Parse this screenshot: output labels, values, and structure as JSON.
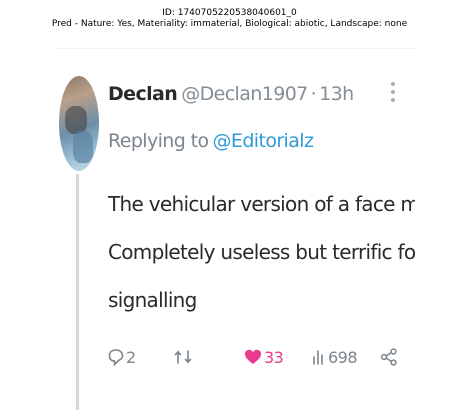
{
  "caption": {
    "line1": "ID: 1740705220538040601_0",
    "line2": "Pred - Nature: Yes, Materiality: immaterial, Biological: abiotic, Landscape: none"
  },
  "tweet": {
    "author_name": "Declan",
    "handle": "@Declan1907",
    "separator": "·",
    "time": "13h",
    "replying_prefix": "Replying to",
    "replying_to": "@Editorialz",
    "text_lines": [
      "The vehicular version of a face mask.",
      "Completely useless but terrific for virtue",
      "signalling"
    ],
    "actions": {
      "replies": "2",
      "reposts": "",
      "likes": "33",
      "views": "698"
    },
    "colors": {
      "like": "#ea3a8a",
      "mention": "#2f9bd8",
      "muted": "#7b858d"
    },
    "icons": [
      "more-icon",
      "reply-icon",
      "repost-icon",
      "heart-icon",
      "views-icon",
      "share-icon"
    ]
  }
}
